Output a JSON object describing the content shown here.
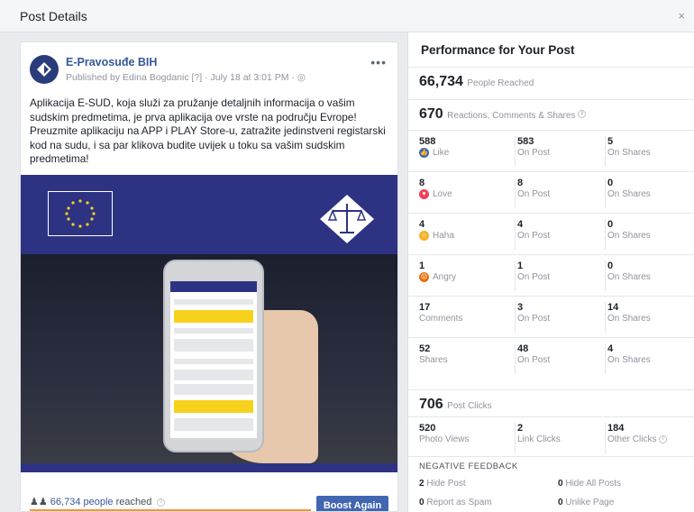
{
  "modal": {
    "title": "Post Details",
    "close": "×"
  },
  "post": {
    "page_name": "E-Pravosuđe BIH",
    "meta": "Published by Edina Bogdanic [?] · July 18 at 3:01 PM · ",
    "more": "•••",
    "text": "Aplikacija E-SUD, koja služi za pružanje detaljnih informacija o vašim sudskim predmetima, je prva aplikacija ove vrste na području Evrope! Preuzmite aplikaciju na APP i PLAY Store-u, zatražite jedinstveni registarski kod na sudu, i sa par klikova budite uvijek u toku sa vašim sudskim predmetima!",
    "reach_num": "66,734 people",
    "reach_label": " reached",
    "boost_label": "Boost Again"
  },
  "panel": {
    "title": "Performance for Your Post",
    "people_reached": {
      "value": "66,734",
      "label": "People Reached"
    },
    "engagement": {
      "value": "670",
      "label": "Reactions, Comments & Shares"
    },
    "reactions": [
      {
        "total": "588",
        "label": "Like",
        "icon": "like-icon",
        "on_post": "583",
        "on_shares": "5"
      },
      {
        "total": "8",
        "label": "Love",
        "icon": "love-icon",
        "on_post": "8",
        "on_shares": "0"
      },
      {
        "total": "4",
        "label": "Haha",
        "icon": "haha-icon",
        "on_post": "4",
        "on_shares": "0"
      },
      {
        "total": "1",
        "label": "Angry",
        "icon": "angry-icon",
        "on_post": "1",
        "on_shares": "0"
      },
      {
        "total": "17",
        "label": "Comments",
        "icon": "",
        "on_post": "3",
        "on_shares": "14"
      },
      {
        "total": "52",
        "label": "Shares",
        "icon": "",
        "on_post": "48",
        "on_shares": "4"
      }
    ],
    "on_post_label": "On Post",
    "on_shares_label": "On Shares",
    "post_clicks": {
      "value": "706",
      "label": "Post Clicks"
    },
    "clicks": [
      {
        "value": "520",
        "label": "Photo Views"
      },
      {
        "value": "2",
        "label": "Link Clicks"
      },
      {
        "value": "184",
        "label": "Other Clicks"
      }
    ],
    "negative_title": "NEGATIVE FEEDBACK",
    "negative": [
      {
        "value": "2",
        "label": "Hide Post"
      },
      {
        "value": "0",
        "label": "Hide All Posts"
      },
      {
        "value": "0",
        "label": "Report as Spam"
      },
      {
        "value": "0",
        "label": "Unlike Page"
      }
    ]
  },
  "colors": {
    "brand": "#4267b2",
    "link": "#365899",
    "image_bg": "#2d3382",
    "progress": "#f7923a"
  }
}
